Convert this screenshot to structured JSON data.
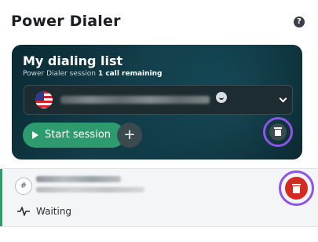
{
  "header": {
    "title": "Power Dialer",
    "help_glyph": "?"
  },
  "card": {
    "title": "My dialing list",
    "subtitle": "Power Dialer session",
    "remaining": "1 call remaining",
    "selector_icon": "us-flag-icon",
    "start_label": "Start session",
    "add_glyph": "+"
  },
  "queue": {
    "items": [
      {
        "type_glyph": "#",
        "status": "Waiting"
      }
    ]
  },
  "colors": {
    "accent_green": "#2e9b6e",
    "highlight_purple": "#8d55e8",
    "danger_red": "#d6291f",
    "card_dark": "#0d3844"
  }
}
